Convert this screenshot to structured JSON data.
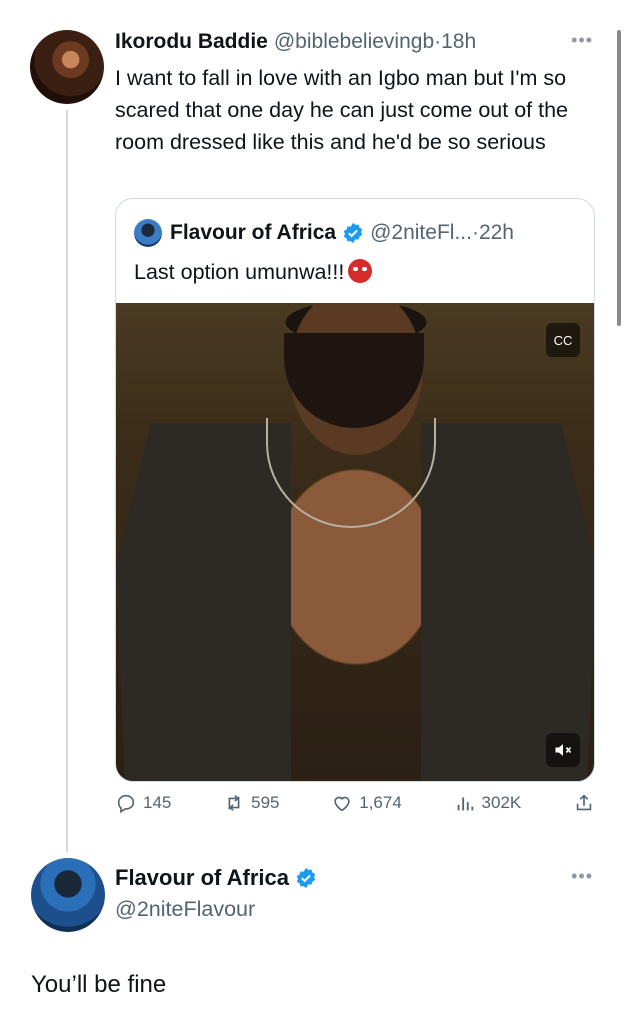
{
  "main_tweet": {
    "author_name": "Ikorodu Baddie",
    "handle": "@biblebelievingb",
    "separator": "·",
    "time": "18h",
    "text": "I want to fall in love with an Igbo man but I'm so scared that one day he can just come out of the room dressed like this and he'd be so serious",
    "more_icon": "more-horizontal-icon"
  },
  "quoted_tweet": {
    "author_name": "Flavour of Africa",
    "verified": true,
    "handle": "@2niteFl...",
    "separator": "·",
    "time": "22h",
    "text": "Last option umunwa!!!",
    "emoji_icon": "ogre-face-icon",
    "media": {
      "type": "video",
      "captions_icon": "captions-icon",
      "mute_icon": "volume-mute-icon"
    }
  },
  "actions": {
    "replies": "145",
    "reposts": "595",
    "likes": "1,674",
    "views": "302K"
  },
  "reply": {
    "author_name": "Flavour of Africa",
    "verified": true,
    "handle": "@2niteFlavour",
    "text": "You’ll be fine"
  },
  "colors": {
    "accent": "#1d9bf0",
    "secondary_text": "#536471",
    "border": "#cfd9de"
  }
}
